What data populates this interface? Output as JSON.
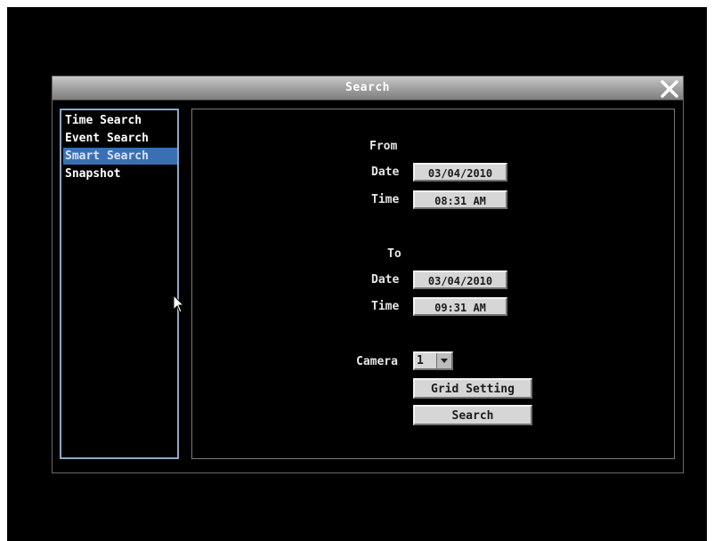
{
  "window": {
    "title": "Search",
    "close_icon": "close-x-icon"
  },
  "sidebar": {
    "items": [
      {
        "label": "Time Search",
        "selected": false
      },
      {
        "label": "Event Search",
        "selected": false
      },
      {
        "label": "Smart Search",
        "selected": true
      },
      {
        "label": "Snapshot",
        "selected": false
      }
    ]
  },
  "search": {
    "from": {
      "heading": "From",
      "date_label": "Date",
      "date_value": "03/04/2010",
      "time_label": "Time",
      "time_value": "08:31 AM"
    },
    "to": {
      "heading": "To",
      "date_label": "Date",
      "date_value": "03/04/2010",
      "time_label": "Time",
      "time_value": "09:31 AM"
    },
    "camera_label": "Camera",
    "camera_value": "1",
    "grid_setting_label": "Grid Setting",
    "search_label": "Search"
  },
  "colors": {
    "background": "#000000",
    "selected_item": "#3a6fb4",
    "field": "#d6d6d6",
    "sidebar_border": "#8ea8c8"
  }
}
